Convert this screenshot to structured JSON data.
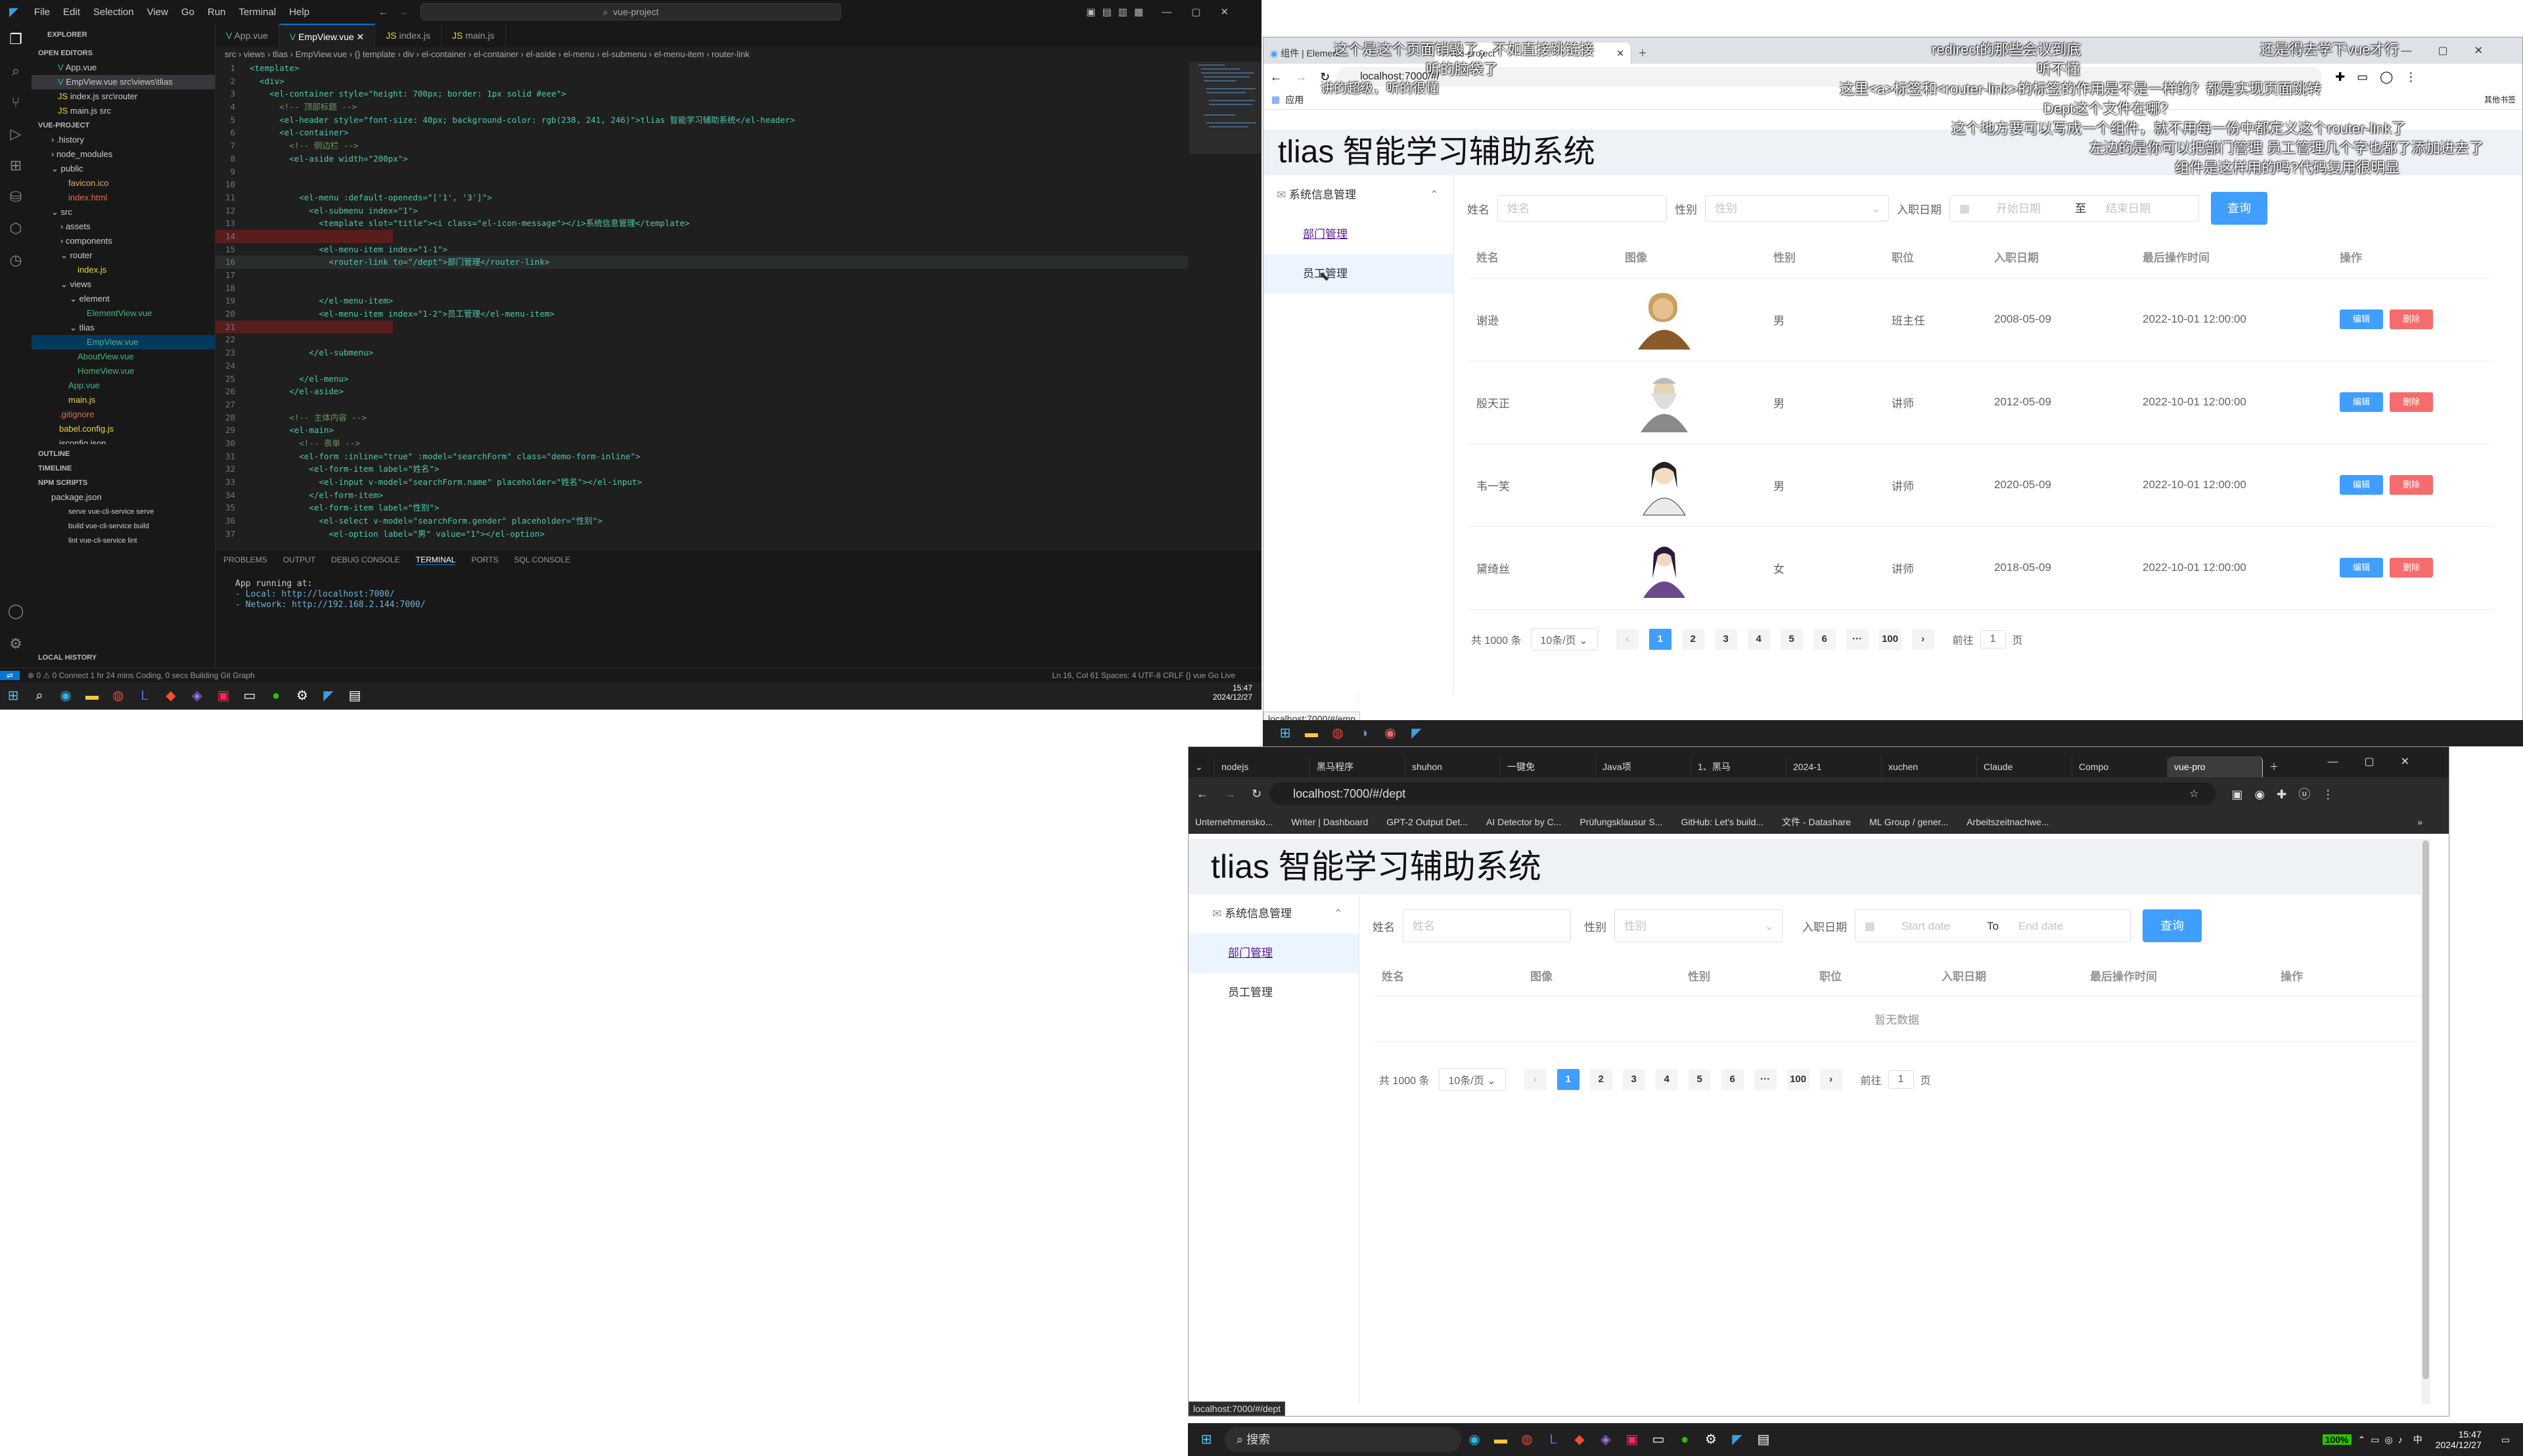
{
  "vscode": {
    "menu": [
      "File",
      "Edit",
      "Selection",
      "View",
      "Go",
      "Run",
      "Terminal",
      "Help"
    ],
    "search": "vue-project",
    "explorer_title": "EXPLORER",
    "open_editors": "OPEN EDITORS",
    "open_files": [
      "App.vue",
      "EmpView.vue src\\views\\tlias",
      "index.js src\\router",
      "main.js src"
    ],
    "project": "VUE-PROJECT",
    "tree": [
      ".history",
      "node_modules",
      "public",
      "favicon.ico",
      "index.html",
      "src",
      "assets",
      "components",
      "router",
      "index.js",
      "views",
      "element",
      "ElementView.vue",
      "tlias",
      "EmpView.vue",
      "AboutView.vue",
      "HomeView.vue",
      "App.vue",
      "main.js",
      ".gitignore",
      "babel.config.js",
      "jsconfig.json"
    ],
    "outline": "OUTLINE",
    "timeline": "TIMELINE",
    "npm_scripts": "NPM SCRIPTS",
    "npm_items": [
      "package.json",
      "serve vue-cli-service serve",
      "build vue-cli-service build",
      "lint vue-cli-service lint"
    ],
    "local_history": "LOCAL HISTORY",
    "tabs": [
      "App.vue",
      "EmpView.vue",
      "index.js",
      "main.js"
    ],
    "breadcrumbs": "src › views › tlias › EmpView.vue › {} template › div › el-container › el-container › el-aside › el-menu › el-submenu › el-menu-item › router-link",
    "code": [
      "<template>",
      "  <div>",
      "    <el-container style=\"height: 700px; border: 1px solid #eee\">",
      "      <!-- 顶部标题 -->",
      "      <el-header style=\"font-size: 40px; background-color: rgb(238, 241, 246)\">tlias 智能学习辅助系统</el-header>",
      "      <el-container>",
      "        <!-- 侧边栏 -->",
      "        <el-aside width=\"200px\">",
      "",
      "",
      "          <el-menu :default-openeds=\"['1', '3']\">",
      "            <el-submenu index=\"1\">",
      "              <template slot=\"title\"><i class=\"el-icon-message\"></i>系统信息管理</template>",
      "",
      "              <el-menu-item index=\"1-1\">",
      "                <router-link to=\"/dept\">部门管理</router-link>",
      "",
      "",
      "              </el-menu-item>",
      "              <el-menu-item index=\"1-2\">员工管理</el-menu-item>",
      "",
      "",
      "            </el-submenu>",
      "",
      "          </el-menu>",
      "        </el-aside>",
      "",
      "        <!-- 主体内容 -->",
      "        <el-main>",
      "          <!-- 表单 -->",
      "          <el-form :inline=\"true\" :model=\"searchForm\" class=\"demo-form-inline\">",
      "            <el-form-item label=\"姓名\">",
      "              <el-input v-model=\"searchForm.name\" placeholder=\"姓名\"></el-input>",
      "            </el-form-item>",
      "            <el-form-item label=\"性别\">",
      "              <el-select v-model=\"searchForm.gender\" placeholder=\"性别\">",
      "                <el-option label=\"男\" value=\"1\"></el-option>"
    ],
    "panel_tabs": [
      "PROBLEMS",
      "OUTPUT",
      "DEBUG CONSOLE",
      "TERMINAL",
      "PORTS",
      "SQL CONSOLE"
    ],
    "terminal": [
      "App running at:",
      "- Local:   http://localhost:7000/",
      "- Network: http://192.168.2.144:7000/"
    ],
    "status_left": "⊗ 0 ⚠ 0   Connect   1 hr 24 mins Coding, 0 secs Building   Git Graph",
    "status_right": "Ln 16, Col 61   Spaces: 4   UTF-8   CRLF   {} vue   Go Live",
    "clock1": "15:47",
    "date1": "2024/12/27"
  },
  "browser1": {
    "tabs": [
      "组件 | Element",
      "vue-project"
    ],
    "url": "localhost:7000/#/",
    "bookmark": "应用",
    "other_bookmarks": "其他书签",
    "status_url": "localhost:7000/#/emp"
  },
  "app1": {
    "title": "tlias 智能学习辅助系统",
    "menu_group": "系统信息管理",
    "menu_items": [
      "部门管理",
      "员工管理"
    ],
    "filters": {
      "name_label": "姓名",
      "name_ph": "姓名",
      "gender_label": "性别",
      "gender_ph": "性别",
      "date_label": "入职日期",
      "start_ph": "开始日期",
      "sep": "至",
      "end_ph": "结束日期",
      "query": "查询"
    },
    "columns": [
      "姓名",
      "图像",
      "性别",
      "职位",
      "入职日期",
      "最后操作时间",
      "操作"
    ],
    "rows": [
      {
        "name": "谢逊",
        "gender": "男",
        "job": "班主任",
        "entry": "2008-05-09",
        "updated": "2022-10-01 12:00:00"
      },
      {
        "name": "殷天正",
        "gender": "男",
        "job": "讲师",
        "entry": "2012-05-09",
        "updated": "2022-10-01 12:00:00"
      },
      {
        "name": "韦一笑",
        "gender": "男",
        "job": "讲师",
        "entry": "2020-05-09",
        "updated": "2022-10-01 12:00:00"
      },
      {
        "name": "黛绮丝",
        "gender": "女",
        "job": "讲师",
        "entry": "2018-05-09",
        "updated": "2022-10-01 12:00:00"
      }
    ],
    "edit": "编辑",
    "delete": "删除",
    "pager": {
      "total": "共 1000 条",
      "size": "10条/页",
      "pages": [
        "1",
        "2",
        "3",
        "4",
        "5",
        "6",
        "···",
        "100"
      ],
      "goto": "前往",
      "goto_val": "1",
      "page_unit": "页"
    }
  },
  "danmaku": [
    "这个是这个页面销毁了，不如直接跳链接",
    "听的脑袋了",
    "讲的很好，听的很开",
    "redirect的那些会议到底",
    "听不懂",
    "这里<a>标签和<router-link>的标签的作用是不是一样的？都是实现页面跳转",
    "Dept这个文件在哪？",
    "这个地方要可以写成一个组件，就不用每一份中都定义这个router-link了",
    "左边的是你可以把部门管理 员工管理几个字也都了添加进去了",
    "组件是这样用的吗?代码复用很明显",
    "还是得去学下vue才行"
  ],
  "browser2": {
    "tabs": [
      "nodejs",
      "黑马程序",
      "shuhon",
      "一键免",
      "Java项",
      "1、黑马",
      "2024-1",
      "xuchen",
      "Claude",
      "Compo",
      "vue-pro"
    ],
    "url": "localhost:7000/#/dept",
    "bookmarks": [
      "Unternehmensko...",
      "Writer | Dashboard",
      "GPT-2 Output Det...",
      "AI Detector by C...",
      "Prüfungsklausur S...",
      "GitHub: Let's build...",
      "文件 - Datashare",
      "ML Group / gener...",
      "Arbeitszeitnachwe..."
    ],
    "status_url": "localhost:7000/#/dept"
  },
  "app2": {
    "title": "tlias 智能学习辅助系统",
    "menu_group": "系统信息管理",
    "menu_items": [
      "部门管理",
      "员工管理"
    ],
    "filters": {
      "name_label": "姓名",
      "name_ph": "姓名",
      "gender_label": "性别",
      "gender_ph": "性别",
      "date_label": "入职日期",
      "start_ph": "Start date",
      "sep": "To",
      "end_ph": "End date",
      "query": "查询"
    },
    "columns": [
      "姓名",
      "图像",
      "性别",
      "职位",
      "入职日期",
      "最后操作时间",
      "操作"
    ],
    "empty": "暂无数据",
    "pager": {
      "total": "共 1000 条",
      "size": "10条/页",
      "pages": [
        "1",
        "2",
        "3",
        "4",
        "5",
        "6",
        "···",
        "100"
      ],
      "goto": "前往",
      "goto_val": "1",
      "page_unit": "页"
    }
  },
  "taskbar2": {
    "search": "搜索",
    "battery": "100%",
    "clock": "15:47",
    "date": "2024/12/27",
    "ime": "中"
  },
  "colors": {
    "primary": "#409eff",
    "danger": "#f56c6c",
    "vscode_bg": "#1e1e1e"
  }
}
